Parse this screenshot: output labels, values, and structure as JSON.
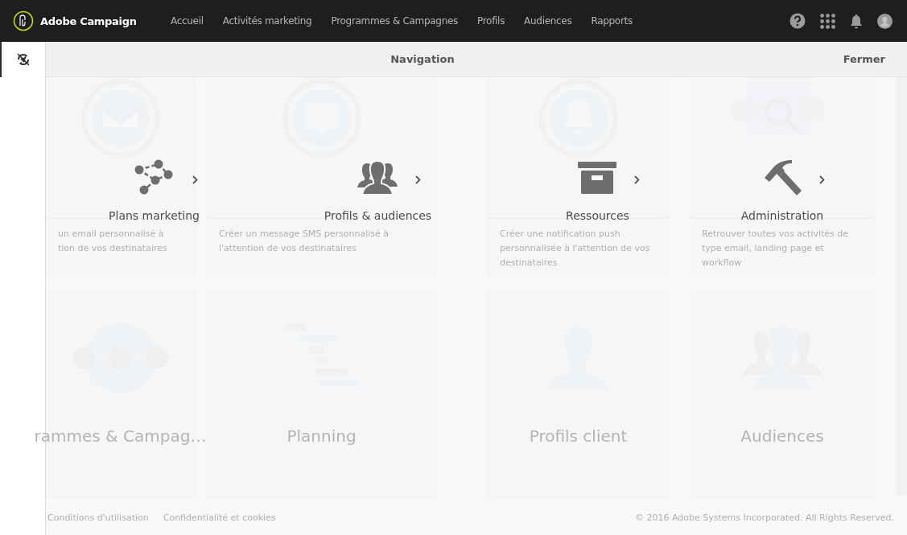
{
  "app": {
    "name": "Adobe Campaign"
  },
  "top_nav": [
    {
      "label": "Accueil"
    },
    {
      "label": "Activités marketing"
    },
    {
      "label": "Programmes & Campagnes"
    },
    {
      "label": "Profils"
    },
    {
      "label": "Audiences"
    },
    {
      "label": "Rapports"
    }
  ],
  "panel": {
    "title": "Navigation",
    "close": "Fermer"
  },
  "navigation_items": [
    {
      "label": "Plans marketing"
    },
    {
      "label": "Profils & audiences"
    },
    {
      "label": "Ressources"
    },
    {
      "label": "Administration"
    }
  ],
  "background_cards": [
    {
      "description": "un email personnalisé à tion de vos destinataires"
    },
    {
      "description": "Créer un message SMS personnalisé à l'attention de vos destinataires"
    },
    {
      "description": "Créer une notification push personnalisée à l'attention de vos destinataires"
    },
    {
      "description": "Retrouver toutes vos activités de type email, landing page et workflow"
    },
    {
      "title": "rammes & Campag…"
    },
    {
      "title": "Planning"
    },
    {
      "title": "Profils client"
    },
    {
      "title": "Audiences"
    }
  ],
  "footer": {
    "links": [
      "Conditions d'utilisation",
      "Confidentialité et cookies"
    ],
    "copyright": "© 2016 Adobe Systems Incorporated. All Rights Reserved."
  }
}
